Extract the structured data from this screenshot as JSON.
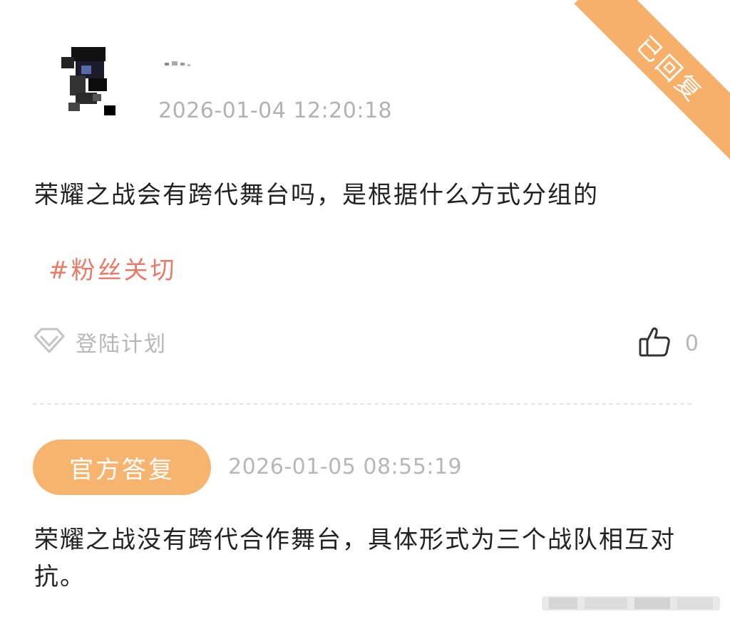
{
  "badge": {
    "status_label": "已回复"
  },
  "question": {
    "time": "2026-01-04 12:20:18",
    "text": "荣耀之战会有跨代舞台吗，是根据什么方式分组的",
    "tag": "#粉丝关切",
    "source_label": "登陆计划",
    "source_icon": "diamond-icon",
    "like_icon": "thumbs-up-icon",
    "like_count": "0"
  },
  "reply": {
    "badge_label": "官方答复",
    "time": "2026-01-05 08:55:19",
    "text": "荣耀之战没有跨代合作舞台，具体形式为三个战队相互对抗。"
  },
  "colors": {
    "accent_orange": "#f7b46f",
    "tag_red": "#ea7a68",
    "muted_gray": "#b7b7b7"
  }
}
